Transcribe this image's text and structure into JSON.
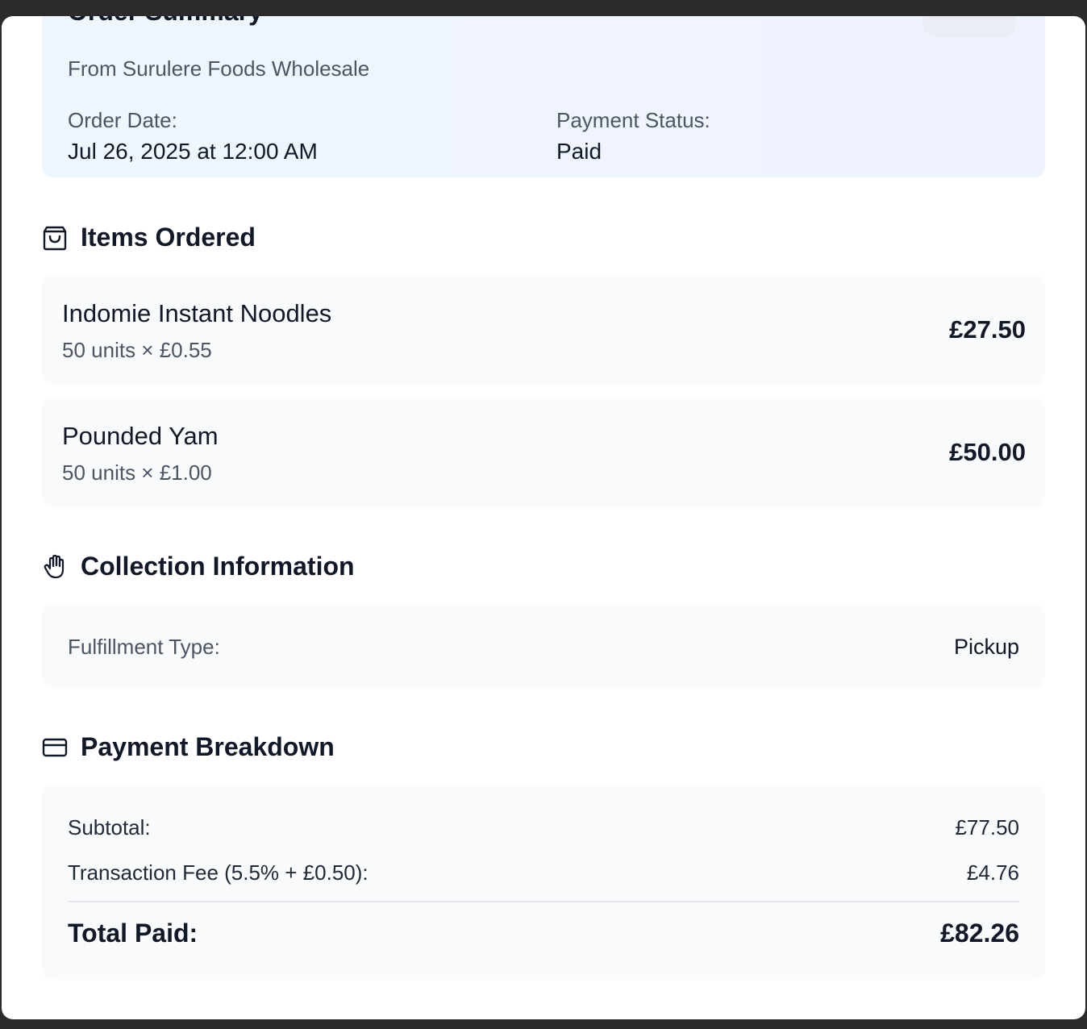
{
  "summary": {
    "title": "Order Summary",
    "vendor": "From Surulere Foods Wholesale",
    "order_date_label": "Order Date:",
    "order_date_value": "Jul 26, 2025 at 12:00 AM",
    "payment_status_label": "Payment Status:",
    "payment_status_value": "Paid"
  },
  "items_section": {
    "title": "Items Ordered",
    "icon": "shopping-bag-icon",
    "items": [
      {
        "name": "Indomie Instant Noodles",
        "qty": "50 units × £0.55",
        "price": "£27.50"
      },
      {
        "name": "Pounded Yam",
        "qty": "50 units × £1.00",
        "price": "£50.00"
      }
    ]
  },
  "collection_section": {
    "title": "Collection Information",
    "icon": "hand-icon",
    "fulfillment_label": "Fulfillment Type:",
    "fulfillment_value": "Pickup"
  },
  "payment_section": {
    "title": "Payment Breakdown",
    "icon": "credit-card-icon",
    "subtotal_label": "Subtotal:",
    "subtotal_value": "£77.50",
    "fee_label": "Transaction Fee (5.5% + £0.50):",
    "fee_value": "£4.76",
    "total_label": "Total Paid:",
    "total_value": "£82.26"
  }
}
